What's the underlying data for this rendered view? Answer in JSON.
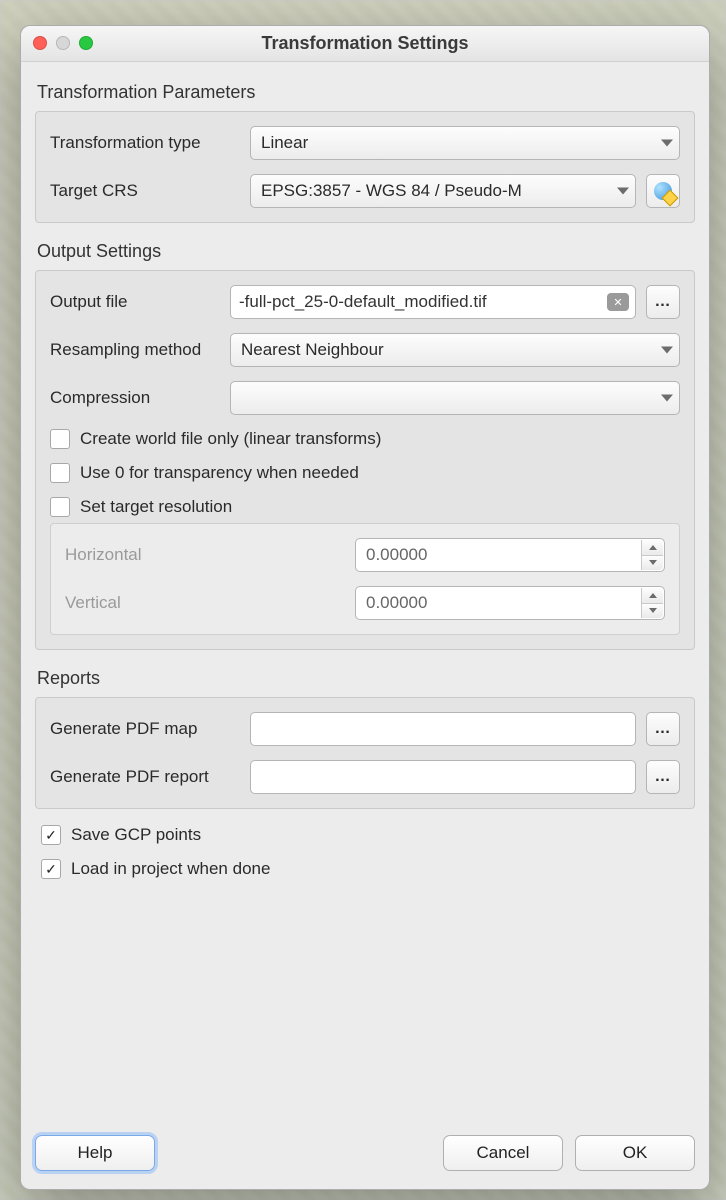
{
  "window": {
    "title": "Transformation Settings"
  },
  "transformation": {
    "section_title": "Transformation Parameters",
    "type_label": "Transformation type",
    "type_value": "Linear",
    "crs_label": "Target CRS",
    "crs_value": "EPSG:3857 - WGS 84 / Pseudo-M"
  },
  "output": {
    "section_title": "Output Settings",
    "file_label": "Output file",
    "file_value": "-full-pct_25-0-default_modified.tif",
    "resample_label": "Resampling method",
    "resample_value": "Nearest Neighbour",
    "compression_label": "Compression",
    "compression_value": "",
    "world_file_label": "Create world file only (linear transforms)",
    "world_file_checked": false,
    "zero_transparency_label": "Use 0 for transparency when needed",
    "zero_transparency_checked": false,
    "set_target_res_label": "Set target resolution",
    "set_target_res_checked": false,
    "horizontal_label": "Horizontal",
    "horizontal_value": "0.00000",
    "vertical_label": "Vertical",
    "vertical_value": "0.00000"
  },
  "reports": {
    "section_title": "Reports",
    "pdf_map_label": "Generate PDF map",
    "pdf_map_value": "",
    "pdf_report_label": "Generate PDF report",
    "pdf_report_value": ""
  },
  "root": {
    "save_gcp_label": "Save GCP points",
    "save_gcp_checked": true,
    "load_project_label": "Load in project when done",
    "load_project_checked": true
  },
  "buttons": {
    "help": "Help",
    "cancel": "Cancel",
    "ok": "OK",
    "browse": "…"
  }
}
